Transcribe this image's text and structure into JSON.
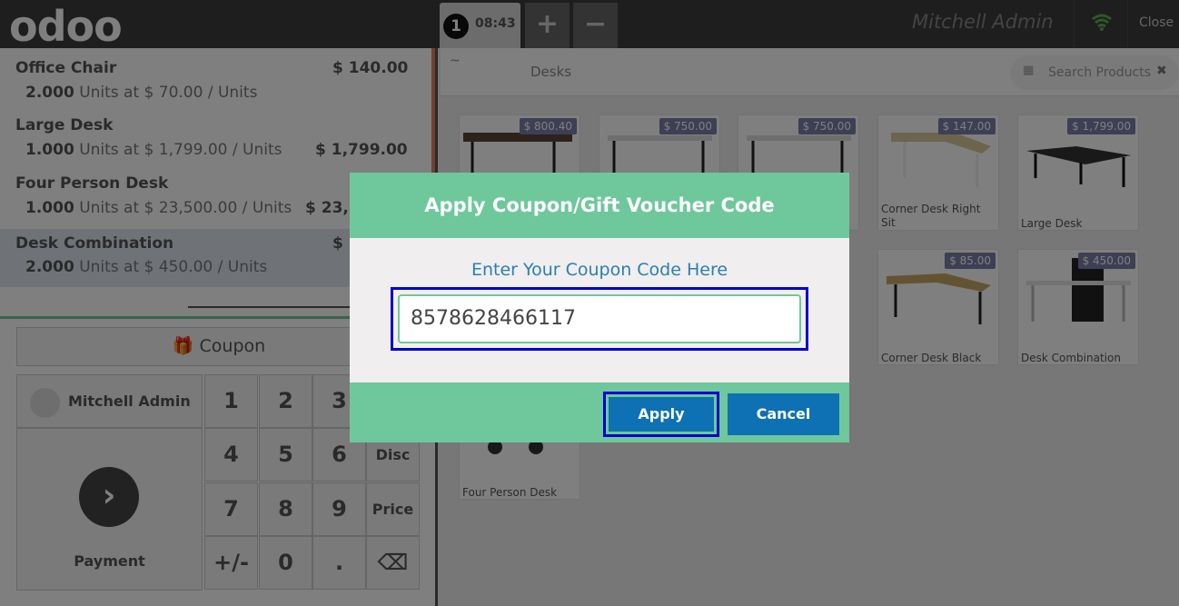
{
  "header": {
    "logo": "odoo",
    "order_number": "1",
    "order_time": "08:43",
    "add_label": "+",
    "remove_label": "−",
    "user": "Mitchell Admin",
    "close_label": "Close"
  },
  "orderlines": [
    {
      "name": "Office Chair",
      "price": "$ 140.00",
      "qty": "2.000",
      "info": "Units at $ 70.00 / Units"
    },
    {
      "name": "Large Desk",
      "price": "$ 1,799.00",
      "qty": "1.000",
      "info": "Units at $ 1,799.00 / Units"
    },
    {
      "name": "Four Person Desk",
      "price": "$ 23,",
      "qty": "1.000",
      "info": "Units at $ 23,500.00 / Units"
    },
    {
      "name": "Desk Combination",
      "price": "$",
      "qty": "2.000",
      "info": "Units at $ 450.00 / Units"
    }
  ],
  "controls": {
    "coupon_label": "Coupon",
    "customer": "Mitchell Admin",
    "payment_label": "Payment",
    "keys": [
      "1",
      "2",
      "3",
      "",
      "4",
      "5",
      "6",
      "Disc",
      "7",
      "8",
      "9",
      "Price",
      "+/-",
      "0",
      ".",
      "⌫"
    ]
  },
  "products_panel": {
    "home": "~",
    "category": "Desks",
    "search_placeholder": "Search Products",
    "products": [
      {
        "name": "",
        "price": "$ 800.40"
      },
      {
        "name": "",
        "price": "$ 750.00"
      },
      {
        "name": "",
        "price": "$ 750.00"
      },
      {
        "name": "Corner Desk Right Sit",
        "price": "$ 147.00"
      },
      {
        "name": "Large Desk",
        "price": "$ 1,799.00"
      },
      {
        "name": "",
        "price": ""
      },
      {
        "name": "",
        "price": ""
      },
      {
        "name": "",
        "price": ""
      },
      {
        "name": "Corner Desk Black",
        "price": "$ 85.00"
      },
      {
        "name": "Desk Combination",
        "price": "$ 450.00"
      },
      {
        "name": "Four Person Desk",
        "price": ""
      }
    ]
  },
  "modal": {
    "title": "Apply Coupon/Gift Voucher Code",
    "subtitle": "Enter Your Coupon Code Here",
    "code": "8578628466117",
    "apply_label": "Apply",
    "cancel_label": "Cancel"
  },
  "colors": {
    "modal_accent": "#6ec89b",
    "button_blue": "#0d71b3",
    "focus_outline": "#0000cc"
  }
}
